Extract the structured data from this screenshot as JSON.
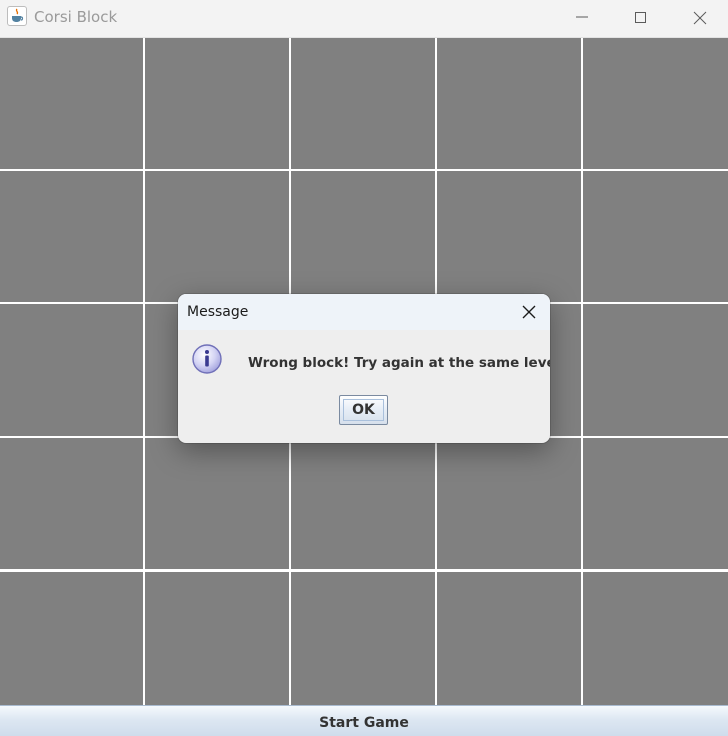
{
  "window": {
    "title": "Corsi Block",
    "icon": "java-cup-icon",
    "controls": [
      "minimize-icon",
      "maximize-icon",
      "close-icon"
    ]
  },
  "grid": {
    "rows": 5,
    "columns": 5,
    "block_color": "#808080",
    "line_color": "#ffffff"
  },
  "start_button": {
    "label": "Start Game"
  },
  "dialog": {
    "title": "Message",
    "icon": "info-icon",
    "message": "Wrong block! Try again at the same level.",
    "ok_label": "OK"
  }
}
